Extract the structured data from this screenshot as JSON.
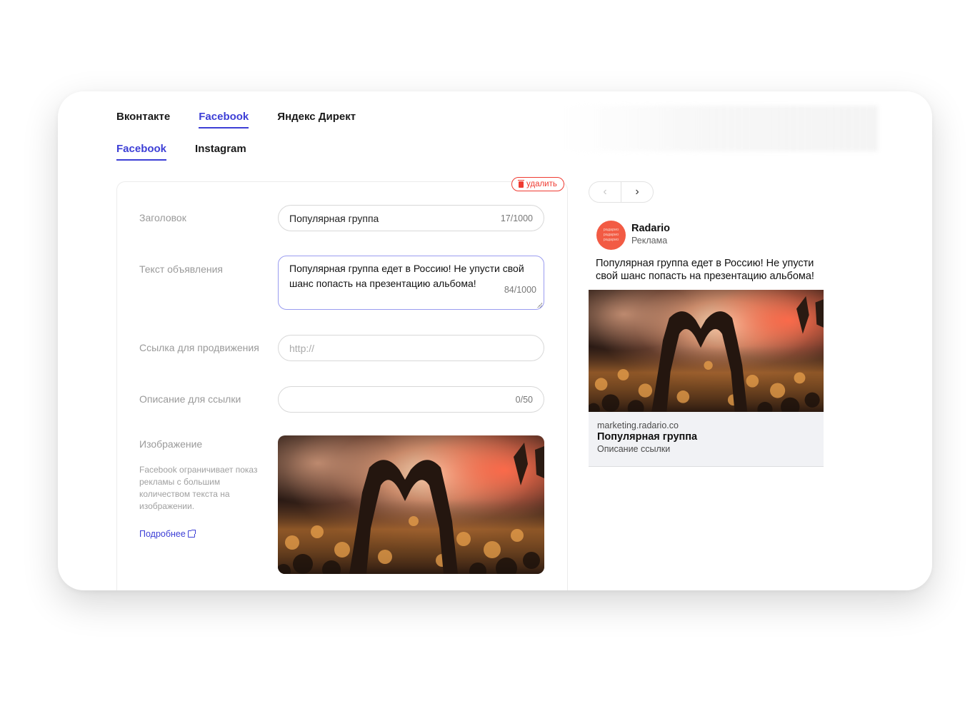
{
  "tabs": [
    "Вконтакте",
    "Facebook",
    "Яндекс Директ"
  ],
  "subtabs": [
    "Facebook",
    "Instagram"
  ],
  "delete_label": "удалить",
  "form": {
    "title_label": "Заголовок",
    "title_value": "Популярная группа",
    "title_counter": "17/1000",
    "text_label": "Текст объявления",
    "text_value": "Популярная группа едет в Россию! Не упусти свой шанс попасть на презентацию альбома!",
    "text_counter": "84/1000",
    "link_label": "Ссылка для продвижения",
    "link_placeholder": "http://",
    "desc_label": "Описание для ссылки",
    "desc_counter": "0/50",
    "image_label": "Изображение",
    "image_hint": "Facebook ограничивает показ рекламы с большим количеством текста на изображении.",
    "more_link": "Подробнее"
  },
  "preview": {
    "nav_prev": "‹",
    "nav_next": "›",
    "avatar_text": [
      "радарио",
      "радарио",
      "радарио"
    ],
    "brand": "Radario",
    "sponsored": "Реклама",
    "text": "Популярная группа едет в Россию! Не упусти свой шанс попасть на презентацию альбома!",
    "domain": "marketing.radario.co",
    "headline": "Популярная группа",
    "link_description": "Описание ссылки"
  },
  "colors": {
    "accent": "#3d3fd6",
    "danger": "#ef3b32",
    "avatar": "#f25b44"
  }
}
